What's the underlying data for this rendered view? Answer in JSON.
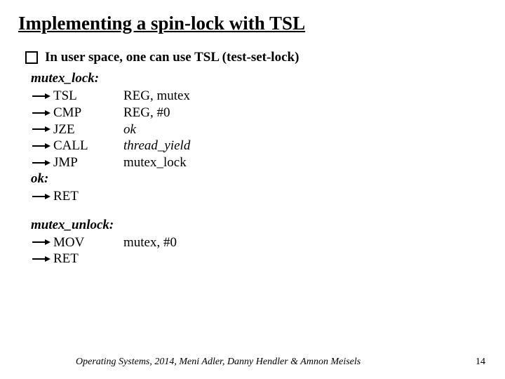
{
  "title": "Implementing a spin-lock with TSL",
  "bullet": "In user space, one can use TSL (test-set-lock)",
  "mutex_lock_label": "mutex_lock:",
  "lock_instr": [
    {
      "mn": "TSL",
      "op": "REG, mutex",
      "op_italic": false
    },
    {
      "mn": "CMP",
      "op": "REG, #0",
      "op_italic": false
    },
    {
      "mn": "JZE",
      "op": "ok",
      "op_italic": true
    },
    {
      "mn": "CALL",
      "op": "thread_yield",
      "op_italic": true
    },
    {
      "mn": "JMP",
      "op": " mutex_lock",
      "op_italic": false
    }
  ],
  "ok_label": "ok:",
  "ok_instr": [
    {
      "mn": "RET",
      "op": "",
      "op_italic": false
    }
  ],
  "mutex_unlock_label": "mutex_unlock:",
  "unlock_instr": [
    {
      "mn": "MOV",
      "op": "mutex, #0",
      "op_italic": false
    },
    {
      "mn": "RET",
      "op": "",
      "op_italic": false
    }
  ],
  "footer": "Operating Systems, 2014, Meni Adler, Danny Hendler & Amnon Meisels",
  "page": "14"
}
